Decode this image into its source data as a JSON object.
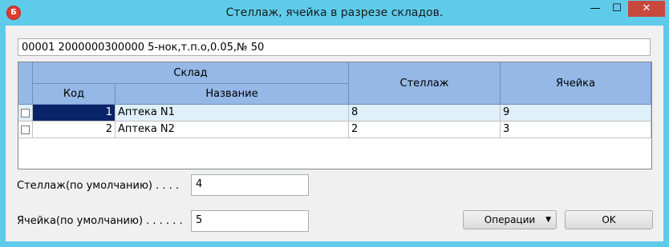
{
  "window": {
    "icon_letter": "Б",
    "title": "Стеллаж, ячейка в разрезе складов.",
    "min_glyph": "—",
    "max_glyph": "☐",
    "close_glyph": "✕"
  },
  "info": {
    "text": "00001 2000000300000 5-нок,т.п.о,0.05,№  50"
  },
  "grid": {
    "group_header": "Склад",
    "columns": {
      "code": "Код",
      "name": "Название",
      "rack": "Стеллаж",
      "cell": "Ячейка"
    },
    "rows": [
      {
        "code": "1",
        "name": "Аптека N1",
        "rack": "8",
        "cell": "9"
      },
      {
        "code": "2",
        "name": "Аптека N2",
        "rack": "2",
        "cell": "3"
      }
    ]
  },
  "form": {
    "rack_label": "Стеллаж(по умолчанию) . . . .",
    "rack_value": "4",
    "cell_label": "Ячейка(по умолчанию) . . . . . .",
    "cell_value": "5"
  },
  "buttons": {
    "operations": "Операции",
    "ok": "OK"
  },
  "colors": {
    "frame": "#5fcbea",
    "header": "#95b8e6",
    "selected_row": "#dff0fb",
    "selected_cell": "#0a246a",
    "close": "#c7483d"
  }
}
